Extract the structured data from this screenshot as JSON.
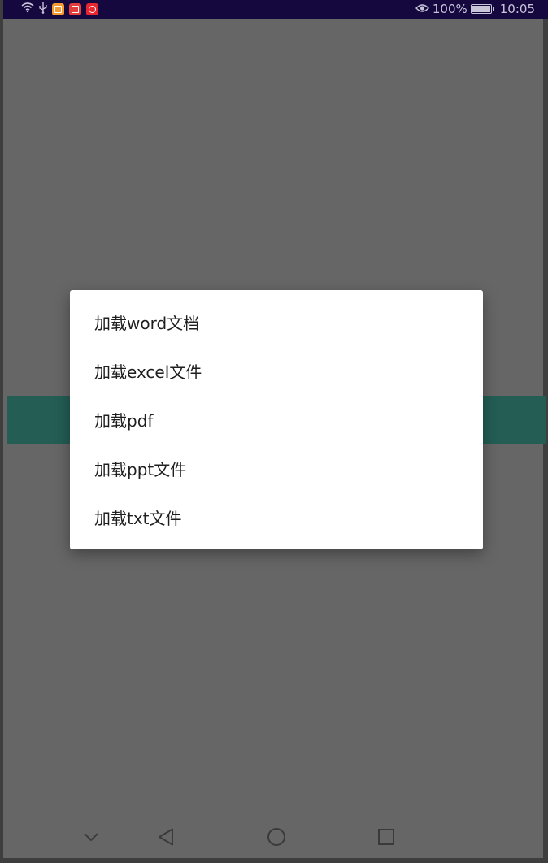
{
  "status_bar": {
    "battery_percent": "100%",
    "battery_level": 1.0,
    "time": "10:05",
    "icons": [
      "wifi-icon",
      "usb-icon",
      "app-notification-icon",
      "app-notification-icon",
      "app-notification-icon",
      "eye-icon",
      "battery-icon"
    ],
    "colors": {
      "background": "#14083f",
      "foreground": "#c9c5d8"
    }
  },
  "dialog": {
    "items": [
      {
        "label": "加载word文档"
      },
      {
        "label": "加载excel文件"
      },
      {
        "label": "加载pdf"
      },
      {
        "label": "加载ppt文件"
      },
      {
        "label": "加载txt文件"
      }
    ]
  },
  "nav_bar": {
    "buttons": [
      "chevron-down-icon",
      "back-icon",
      "home-icon",
      "recents-icon"
    ]
  },
  "colors": {
    "scrim": "#666666",
    "app_bar": "#235d54",
    "dialog_bg": "#ffffff"
  }
}
